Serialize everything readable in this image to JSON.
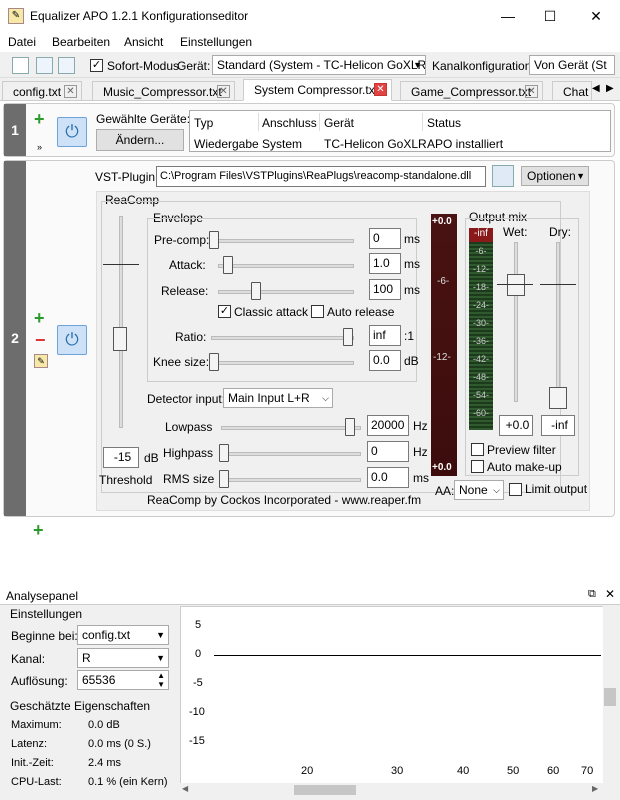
{
  "window": {
    "title": "Equalizer APO 1.2.1 Konfigurationseditor"
  },
  "menu": [
    "Datei",
    "Bearbeiten",
    "Ansicht",
    "Einstellungen"
  ],
  "toolbar": {
    "instant_mode": "Sofort-Modus",
    "device_label": "Gerät:",
    "device_value": "Standard (System - TC-Helicon GoXLR)",
    "channel_label": "Kanalkonfiguration:",
    "channel_value": "Von Gerät (St"
  },
  "tabs": [
    {
      "label": "config.txt"
    },
    {
      "label": "Music_Compressor.txt"
    },
    {
      "label": "System Compressor.txt"
    },
    {
      "label": "Game_Compressor.txt"
    },
    {
      "label": "Chat"
    }
  ],
  "section1": {
    "number": "1",
    "selected_label": "Gewählte Geräte:",
    "change_button": "Ändern...",
    "headers": [
      "Typ",
      "Anschluss",
      "Gerät",
      "Status"
    ],
    "row": [
      "Wiedergabe",
      "System",
      "TC-Helicon GoXLR",
      "APO installiert"
    ]
  },
  "section2": {
    "number": "2",
    "vst_label": "VST-Plugin:",
    "vst_path": "C:\\Program Files\\VSTPlugins\\ReaPlugs\\reacomp-standalone.dll",
    "options_button": "Optionen"
  },
  "reacomp": {
    "group": "ReaComp",
    "envelope": "Envelope",
    "precomp": {
      "label": "Pre-comp:",
      "value": "0",
      "unit": "ms"
    },
    "attack": {
      "label": "Attack:",
      "value": "1.0",
      "unit": "ms"
    },
    "release": {
      "label": "Release:",
      "value": "100",
      "unit": "ms"
    },
    "classic_attack": "Classic attack",
    "auto_release": "Auto release",
    "ratio": {
      "label": "Ratio:",
      "value": "inf",
      "unit": ":1"
    },
    "knee": {
      "label": "Knee size:",
      "value": "0.0",
      "unit": "dB"
    },
    "threshold": {
      "value": "-15",
      "unit": "dB",
      "label": "Threshold"
    },
    "detector": {
      "label": "Detector input:",
      "value": "Main Input L+R"
    },
    "lowpass": {
      "label": "Lowpass",
      "value": "20000",
      "unit": "Hz"
    },
    "highpass": {
      "label": "Highpass",
      "value": "0",
      "unit": "Hz"
    },
    "rms": {
      "label": "RMS size",
      "value": "0.0",
      "unit": "ms"
    },
    "credit": "ReaComp by Cockos Incorporated - www.reaper.fm",
    "meter": {
      "top": "+0.0",
      "marks": [
        "-6-",
        "-12-"
      ],
      "bottom": "+0.0"
    },
    "output_mix": "Output mix",
    "gr_top": "-inf",
    "gr_marks": [
      "-6-",
      "-12-",
      "-18-",
      "-24-",
      "-30-",
      "-36-",
      "-42-",
      "-48-",
      "-54-",
      "-60-"
    ],
    "wet": {
      "label": "Wet:",
      "value": "+0.0"
    },
    "dry": {
      "label": "Dry:",
      "value": "-inf"
    },
    "preview_filter": "Preview filter",
    "auto_makeup": "Auto make-up",
    "aa_label": "AA:",
    "aa_value": "None",
    "limit_output": "Limit output"
  },
  "analysis": {
    "title": "Analysepanel",
    "settings": "Einstellungen",
    "start_label": "Beginne bei:",
    "start_value": "config.txt",
    "channel_label": "Kanal:",
    "channel_value": "R",
    "resolution_label": "Auflösung:",
    "resolution_value": "65536",
    "props": "Geschätzte Eigenschaften",
    "rows": [
      {
        "k": "Maximum:",
        "v": "0.0 dB"
      },
      {
        "k": "Latenz:",
        "v": "0.0 ms (0 S.)"
      },
      {
        "k": "Init.-Zeit:",
        "v": "2.4 ms"
      },
      {
        "k": "CPU-Last:",
        "v": "0.1 % (ein Kern)"
      }
    ],
    "y_ticks": [
      "5",
      "0",
      "-5",
      "-10",
      "-15"
    ],
    "x_ticks": [
      "20",
      "30",
      "40",
      "50",
      "60",
      "70"
    ]
  }
}
